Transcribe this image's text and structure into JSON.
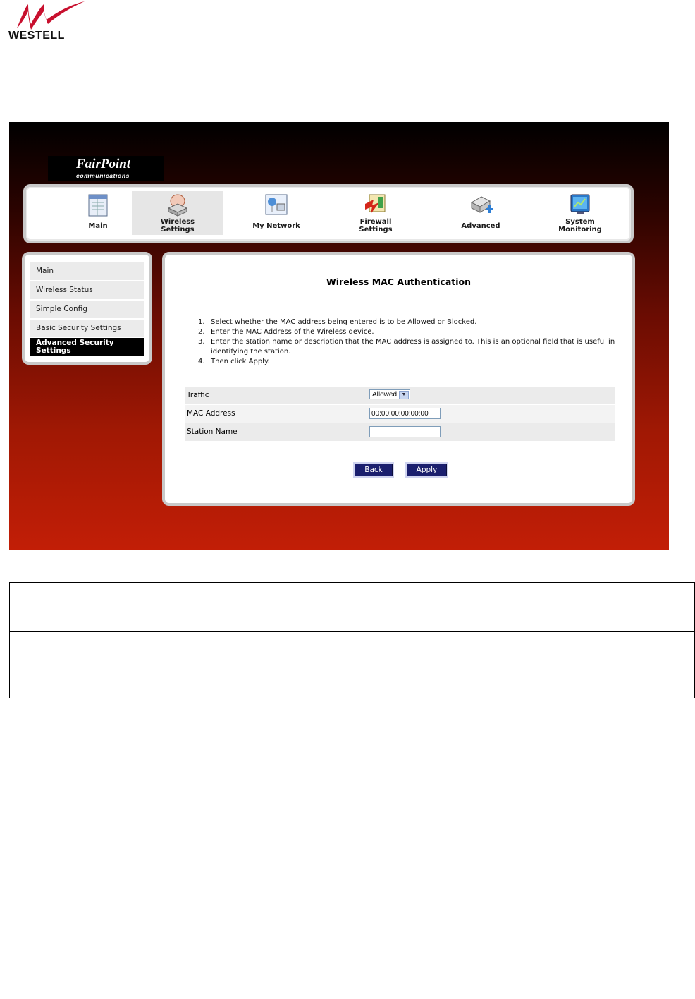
{
  "logo": {
    "text": "WESTELL"
  },
  "brand": {
    "line1": "FairPoint",
    "line2": "communications"
  },
  "nav": [
    {
      "label_l1": "Main",
      "label_l2": ""
    },
    {
      "label_l1": "Wireless",
      "label_l2": "Settings"
    },
    {
      "label_l1": "My Network",
      "label_l2": ""
    },
    {
      "label_l1": "Firewall",
      "label_l2": "Settings"
    },
    {
      "label_l1": "Advanced",
      "label_l2": ""
    },
    {
      "label_l1": "System",
      "label_l2": "Monitoring"
    }
  ],
  "sidebar": {
    "items": [
      {
        "label": "Main"
      },
      {
        "label": "Wireless Status"
      },
      {
        "label": "Simple Config"
      },
      {
        "label": "Basic Security Settings"
      },
      {
        "label": "Advanced Security Settings"
      }
    ]
  },
  "main": {
    "title": "Wireless MAC Authentication",
    "steps": [
      {
        "num": "1.",
        "text": "Select whether the MAC address being entered is to be Allowed or Blocked."
      },
      {
        "num": "2.",
        "text": "Enter the MAC Address of the Wireless device."
      },
      {
        "num": "3.",
        "text": "Enter the station name or description that the MAC address is assigned to. This is an optional field that is useful in identifying the station."
      },
      {
        "num": "4.",
        "text": "Then click Apply."
      }
    ],
    "form": {
      "traffic_label": "Traffic",
      "traffic_value": "Allowed",
      "mac_label": "MAC Address",
      "mac_value": "00:00:00:00:00:00",
      "station_label": "Station Name",
      "station_value": ""
    },
    "back_label": "Back",
    "apply_label": "Apply"
  }
}
